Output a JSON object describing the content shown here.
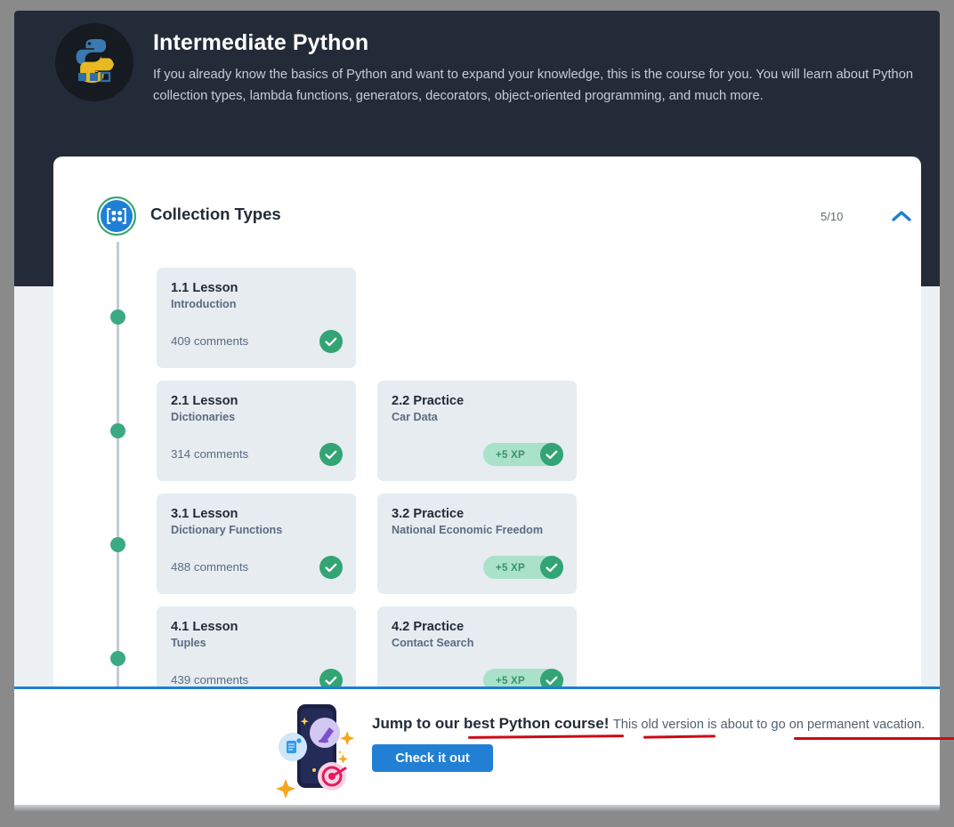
{
  "hero": {
    "logo_icon": "python-logo-icon",
    "title": "Intermediate Python",
    "description": "If you already know the basics of Python and want to expand your knowledge, this is the course for you. You will learn about Python collection types, lambda functions, generators, decorators, object-oriented programming, and much more."
  },
  "section": {
    "icon": "collection-grid-icon",
    "title": "Collection Types",
    "progress": "5/10",
    "collapse_icon": "chevron-up-icon"
  },
  "lessons": [
    {
      "left": {
        "title": "1.1 Lesson",
        "subtitle": "Introduction",
        "comments": "409 comments",
        "status_icon": "check-circle-icon"
      },
      "right": null
    },
    {
      "left": {
        "title": "2.1 Lesson",
        "subtitle": "Dictionaries",
        "comments": "314 comments",
        "status_icon": "check-circle-icon"
      },
      "right": {
        "title": "2.2 Practice",
        "subtitle": "Car Data",
        "xp": "+5 XP",
        "status_icon": "check-circle-icon"
      }
    },
    {
      "left": {
        "title": "3.1 Lesson",
        "subtitle": "Dictionary Functions",
        "comments": "488 comments",
        "status_icon": "check-circle-icon"
      },
      "right": {
        "title": "3.2 Practice",
        "subtitle": "National Economic Freedom",
        "xp": "+5 XP",
        "status_icon": "check-circle-icon"
      }
    },
    {
      "left": {
        "title": "4.1 Lesson",
        "subtitle": "Tuples",
        "comments": "439 comments",
        "status_icon": "check-circle-icon"
      },
      "right": {
        "title": "4.2 Practice",
        "subtitle": "Contact Search",
        "xp": "+5 XP",
        "status_icon": "check-circle-icon"
      }
    }
  ],
  "promo": {
    "illustration_icon": "phone-learning-illustration-icon",
    "headline": "Jump to our best Python course!",
    "subtext": "This old version is about to go on permanent vacation.",
    "button_label": "Check it out"
  },
  "colors": {
    "hero_bg": "#242b38",
    "accent_blue": "#2180d3",
    "success_green": "#33a474",
    "xp_pill": "#a9e2c8",
    "card_bg": "#e6ecf0",
    "annotation_red": "#cc0a16"
  }
}
